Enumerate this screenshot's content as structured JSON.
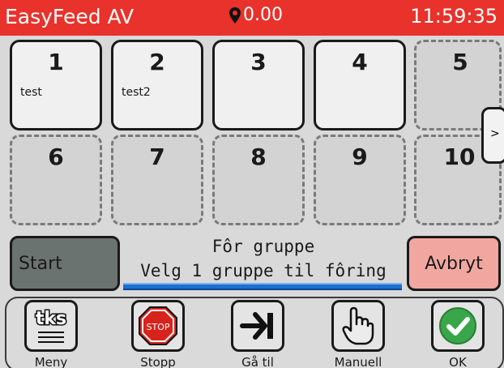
{
  "header": {
    "title": "EasyFeed AV",
    "location_value": "0.00",
    "clock": "11:59:35",
    "bg_color": "#e8322b"
  },
  "groups": [
    {
      "number": "1",
      "name": "test"
    },
    {
      "number": "2",
      "name": "test2"
    },
    {
      "number": "3",
      "name": ""
    },
    {
      "number": "4",
      "name": ""
    },
    {
      "number": "5",
      "name": ""
    },
    {
      "number": "6",
      "name": ""
    },
    {
      "number": "7",
      "name": ""
    },
    {
      "number": "8",
      "name": ""
    },
    {
      "number": "9",
      "name": ""
    },
    {
      "number": "10",
      "name": ""
    }
  ],
  "next_page_label": ">",
  "actions": {
    "start_label": "Start",
    "cancel_label": "Avbryt"
  },
  "status": {
    "title": "Fôr gruppe",
    "message": "Velg 1 gruppe til fôring"
  },
  "toolbar": {
    "menu_label": "Meny",
    "menu_logo_text": "tks",
    "stop_label": "Stopp",
    "stop_sign_text": "STOP",
    "goto_label": "Gå til",
    "manual_label": "Manuell",
    "ok_label": "OK"
  }
}
